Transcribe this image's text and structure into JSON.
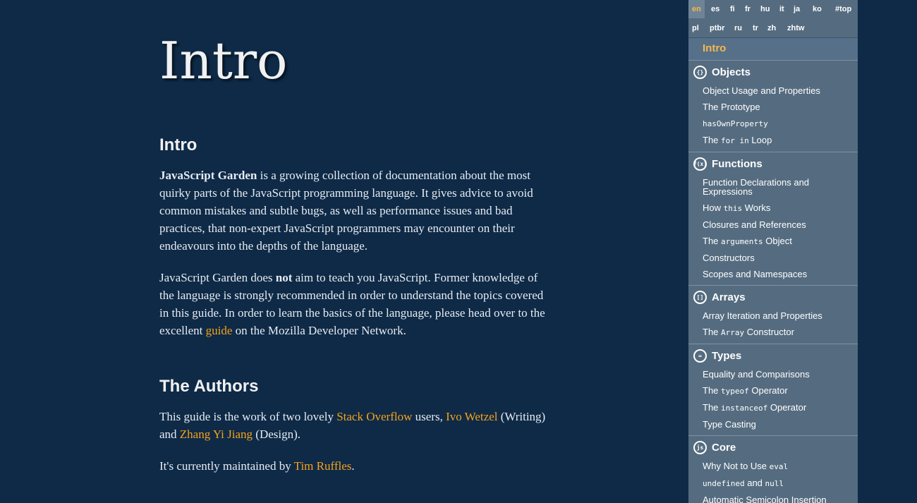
{
  "main": {
    "page_title": "Intro",
    "intro_heading": "Intro",
    "p1": {
      "bold": "JavaScript Garden",
      "rest": " is a growing collection of documentation about the most quirky parts of the JavaScript programming language. It gives advice to avoid common mistakes and subtle bugs, as well as performance issues and bad practices, that non-expert JavaScript programmers may encounter on their endeavours into the depths of the language."
    },
    "p2": {
      "before": "JavaScript Garden does ",
      "bold": "not",
      "middle": " aim to teach you JavaScript. Former knowledge of the language is strongly recommended in order to understand the topics covered in this guide. In order to learn the basics of the language, please head over to the excellent ",
      "link": "guide",
      "after": " on the Mozilla Developer Network."
    },
    "authors_heading": "The Authors",
    "p3": {
      "before": "This guide is the work of two lovely ",
      "link1": "Stack Overflow",
      "mid1": " users, ",
      "link2": "Ivo Wetzel",
      "mid2": " (Writing) and ",
      "link3": "Zhang Yi Jiang",
      "after": " (Design)."
    },
    "p4": {
      "before": "It's currently maintained by ",
      "link": "Tim Ruffles",
      "after": "."
    }
  },
  "sidebar": {
    "languages_row1": [
      "en",
      "es",
      "fi",
      "fr",
      "hu",
      "it",
      "ja",
      "ko",
      "#top"
    ],
    "languages_row2": [
      "pl",
      "ptbr",
      "ru",
      "tr",
      "zh",
      "zhtw"
    ],
    "active_language": "en",
    "intro_link": "Intro",
    "sections": [
      {
        "title": "Objects",
        "icon": "{}",
        "items": [
          {
            "pre": "Object Usage and Properties",
            "code": "",
            "post": ""
          },
          {
            "pre": "The Prototype",
            "code": "",
            "post": ""
          },
          {
            "pre": "",
            "code": "hasOwnProperty",
            "post": ""
          },
          {
            "pre": "The ",
            "code": "for in",
            "post": " Loop"
          }
        ]
      },
      {
        "title": "Functions",
        "icon": "f(x)",
        "items": [
          {
            "pre": "Function Declarations and Expressions",
            "code": "",
            "post": ""
          },
          {
            "pre": "How ",
            "code": "this",
            "post": " Works"
          },
          {
            "pre": "Closures and References",
            "code": "",
            "post": ""
          },
          {
            "pre": "The ",
            "code": "arguments",
            "post": " Object"
          },
          {
            "pre": "Constructors",
            "code": "",
            "post": ""
          },
          {
            "pre": "Scopes and Namespaces",
            "code": "",
            "post": ""
          }
        ]
      },
      {
        "title": "Arrays",
        "icon": "[]",
        "items": [
          {
            "pre": "Array Iteration and Properties",
            "code": "",
            "post": ""
          },
          {
            "pre": "The ",
            "code": "Array",
            "post": " Constructor"
          }
        ]
      },
      {
        "title": "Types",
        "icon": "=",
        "items": [
          {
            "pre": "Equality and Comparisons",
            "code": "",
            "post": ""
          },
          {
            "pre": "The ",
            "code": "typeof",
            "post": " Operator"
          },
          {
            "pre": "The ",
            "code": "instanceof",
            "post": " Operator"
          },
          {
            "pre": "Type Casting",
            "code": "",
            "post": ""
          }
        ]
      },
      {
        "title": "Core",
        "icon": "js",
        "items": [
          {
            "pre": "Why Not to Use ",
            "code": "eval",
            "post": ""
          },
          {
            "pre": "",
            "code": "undefined",
            "post": " and "
          },
          {
            "pre": "Automatic Semicolon Insertion",
            "code": "",
            "post": ""
          }
        ]
      }
    ],
    "core_extra_code": "null"
  },
  "colors": {
    "background": "#0e2a47",
    "sidebar": "#556c80",
    "link": "#f7a21b",
    "active_nav": "#f7b84b"
  }
}
